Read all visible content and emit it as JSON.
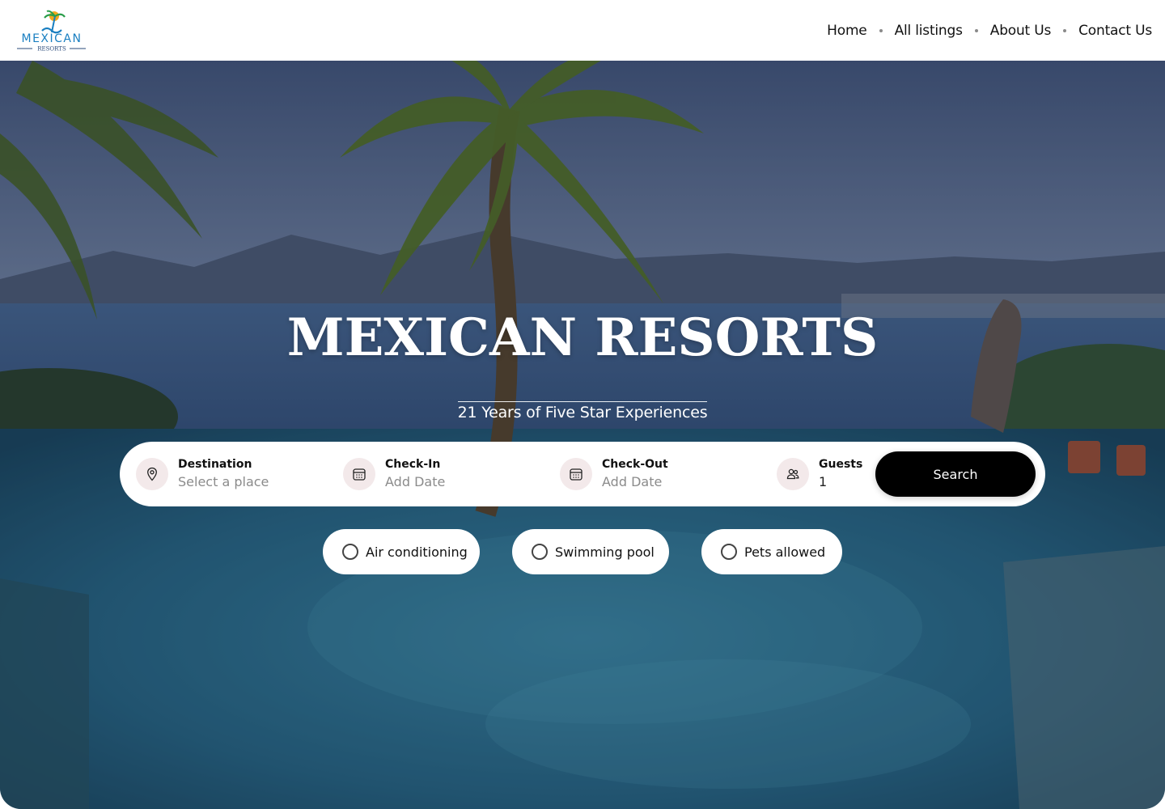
{
  "header": {
    "logo": {
      "wordmark": "MEXICAN",
      "sub": "RESORTS"
    },
    "nav": [
      {
        "label": "Home"
      },
      {
        "label": "All listings"
      },
      {
        "label": "About Us"
      },
      {
        "label": "Contact Us"
      }
    ]
  },
  "hero": {
    "title": "MEXICAN RESORTS",
    "subtitle": "21 Years of Five Star Experiences"
  },
  "search": {
    "fields": [
      {
        "label": "Destination",
        "value": "Select a place",
        "icon": "map-pin-icon"
      },
      {
        "label": "Check-In",
        "value": "Add Date",
        "icon": "calendar-icon"
      },
      {
        "label": "Check-Out",
        "value": "Add Date",
        "icon": "calendar-icon"
      },
      {
        "label": "Guests",
        "value": "1",
        "icon": "users-icon"
      }
    ],
    "button_label": "Search"
  },
  "amenities": [
    {
      "label": "Air conditioning",
      "checked": false
    },
    {
      "label": "Swimming pool",
      "checked": false
    },
    {
      "label": "Pets allowed",
      "checked": false
    }
  ],
  "colors": {
    "logo_blue": "#1a7fc1",
    "logo_navy": "#2a4a7a",
    "icon_bg": "#f3e9ea",
    "button": "#000000"
  }
}
